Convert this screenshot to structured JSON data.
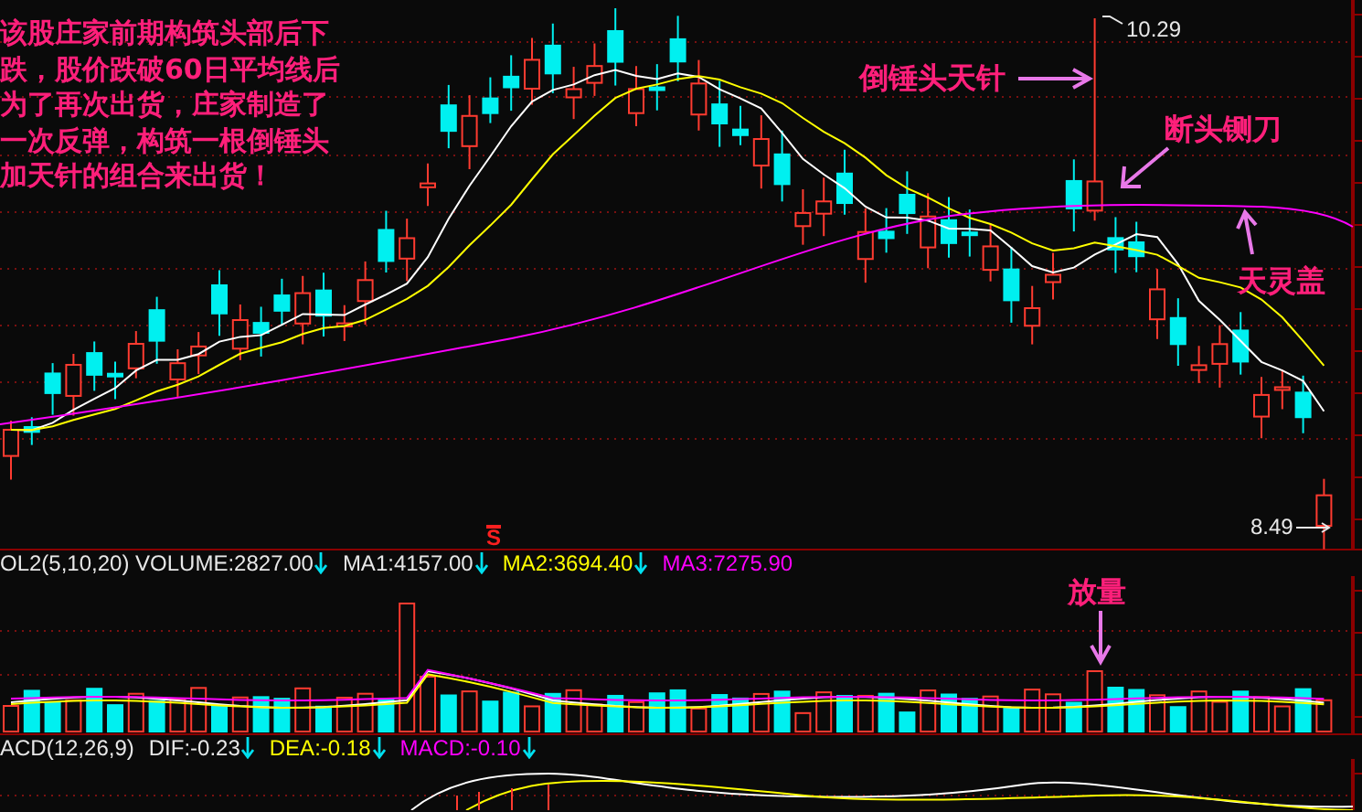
{
  "main_chart": {
    "note_lines": [
      "该股庄家前期构筑头部后下",
      "跌，股价跌破60日平均线后",
      "为了再次出货，庄家制造了",
      "一次反弹，构筑一根倒锤头",
      "加天针的组合来出货！"
    ],
    "callouts": [
      {
        "kind": "right",
        "text": "倒锤头天针"
      },
      {
        "kind": "down-left",
        "text": "断头铡刀"
      },
      {
        "kind": "up",
        "text": "天灵盖"
      }
    ],
    "high_label": "10.29",
    "low_label": "8.49",
    "signal": "S"
  },
  "volume_panel": {
    "indicators": [
      {
        "text": "OL2(5,10,20) VOLUME:2827.00",
        "color": "#e8e8e8",
        "falling": true
      },
      {
        "text": "MA1:4157.00",
        "color": "#e8e8e8",
        "falling": true
      },
      {
        "text": "MA2:3694.40",
        "color": "#ffff00",
        "falling": true
      },
      {
        "text": "MA3:7275.90",
        "color": "#ff00ff",
        "falling": false
      }
    ],
    "callout": "放量"
  },
  "macd_panel": {
    "indicators": [
      {
        "text": "ACD(12,26,9)",
        "color": "#e8e8e8",
        "falling": false
      },
      {
        "text": "DIF:-0.23",
        "color": "#e8e8e8",
        "falling": true
      },
      {
        "text": "DEA:-0.18",
        "color": "#ffff00",
        "falling": true
      },
      {
        "text": "MACD:-0.10",
        "color": "#ff00ff",
        "falling": true
      }
    ]
  }
}
